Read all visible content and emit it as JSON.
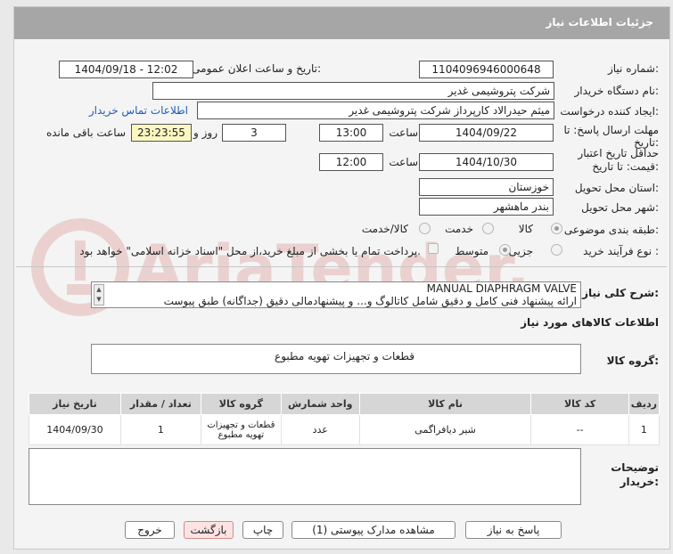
{
  "header": {
    "title": "جزئیات اطلاعات نیاز"
  },
  "fields": {
    "need_number_label": "شماره نیاز:",
    "need_number": "1104096946000648",
    "announce_label": "تاریخ و ساعت اعلان عمومی:",
    "announce_value": "1404/09/18 - 12:02",
    "buyer_org_label": "نام دستگاه خریدار:",
    "buyer_org": "شرکت پتروشیمی غدیر",
    "creator_label": "ایجاد کننده درخواست:",
    "creator": "میثم حیدرالاد کارپرداز شرکت پتروشیمی غدیر",
    "contact_link": "اطلاعات تماس خریدار",
    "deadline_label_1": "مهلت ارسال پاسخ: تا",
    "deadline_label_2": "تاریخ:",
    "deadline_date": "1404/09/22",
    "time_label": "ساعت",
    "deadline_time": "13:00",
    "days_value": "3",
    "days_label": "روز و",
    "remaining_time": "23:23:55",
    "remaining_label": "ساعت باقی مانده",
    "validity_label_1": "حداقل تاریخ اعتبار",
    "validity_label_2": "قیمت: تا تاریخ:",
    "validity_date": "1404/10/30",
    "validity_time": "12:00",
    "province_label": "استان محل تحویل:",
    "province": "خوزستان",
    "city_label": "شهر محل تحویل:",
    "city": "بندر ماهشهر",
    "category_label": "طبقه بندی موضوعی:",
    "category_options": [
      "کالا",
      "خدمت",
      "کالا/خدمت"
    ],
    "purchase_type_label": "نوع فرآیند خرید :",
    "purchase_options": [
      "جزیی",
      "متوسط"
    ],
    "payment_note": "پرداخت تمام یا بخشی از مبلغ خرید،از محل \"اسناد خزانه اسلامی\" خواهد بود."
  },
  "description": {
    "label": "شرح کلی نیاز:",
    "line1": "MANUAL DIAPHRAGM VALVE",
    "line2": "ارائه پیشنهاد فنی کامل و دقیق شامل کاتالوگ و... و پیشنهادمالی دقیق (جداگانه) طبق پیوست"
  },
  "goods_section": {
    "title": "اطلاعات کالاهای مورد نیاز",
    "group_label": "گروه کالا:",
    "group_value": "قطعات و تجهیزات تهویه مطبوع"
  },
  "table": {
    "headers": [
      "ردیف",
      "کد کالا",
      "نام کالا",
      "واحد شمارش",
      "گروه کالا",
      "تعداد / مقدار",
      "تاریخ نیاز"
    ],
    "rows": [
      [
        "1",
        "--",
        "شیر دیافراگمی",
        "عدد",
        "قطعات و تجهیزات تهویه مطبوع",
        "1",
        "1404/09/30"
      ]
    ]
  },
  "notes": {
    "label_1": "توضیحات",
    "label_2": "خریدار:"
  },
  "buttons": {
    "reply": "پاسخ به نیاز",
    "attachments": "مشاهده مدارک پیوستی (1)",
    "print": "چاپ",
    "back": "بازگشت",
    "exit": "خروج"
  },
  "watermark": "AriaTender.net"
}
